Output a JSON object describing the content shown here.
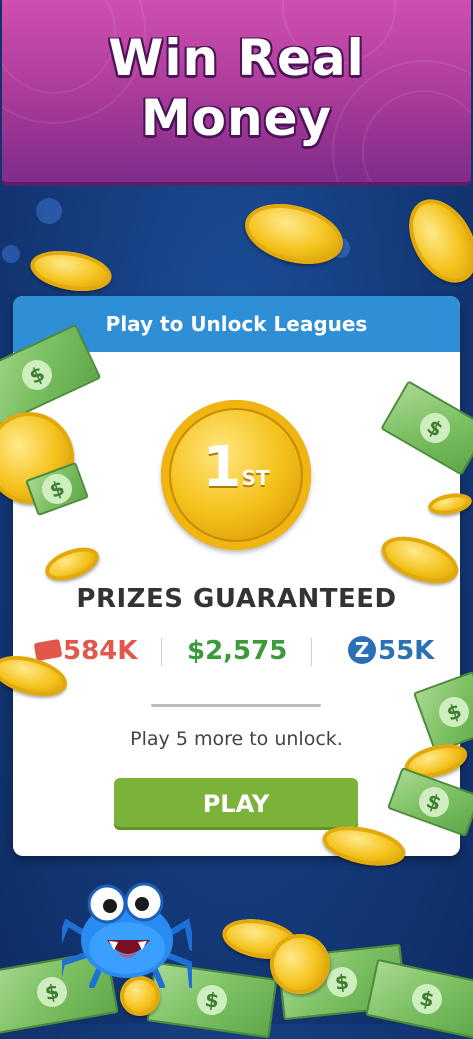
{
  "banner": {
    "title_line1": "Win Real",
    "title_line2": "Money"
  },
  "card": {
    "header": "Play to Unlock Leagues",
    "medal": {
      "number": "1",
      "suffix": "ST"
    },
    "prizes_title": "PRIZES GUARANTEED",
    "prizes": {
      "tickets": "584K",
      "cash": "$2,575",
      "z_icon_letter": "Z",
      "z_points": "55K"
    },
    "unlock_text": "Play 5 more to unlock.",
    "play_label": "PLAY"
  },
  "icons": {
    "ticket": "ticket-icon",
    "z_currency": "z-coin-icon",
    "mascot": "blue-spider-mascot",
    "decor": [
      "gold-coin-icon",
      "dollar-bill-icon"
    ]
  },
  "colors": {
    "banner": "#b1409e",
    "header": "#2f8fd6",
    "play_button": "#7bb33a",
    "tickets": "#e2574c",
    "cash": "#3c9a3a",
    "z_points": "#2b6fb5"
  }
}
